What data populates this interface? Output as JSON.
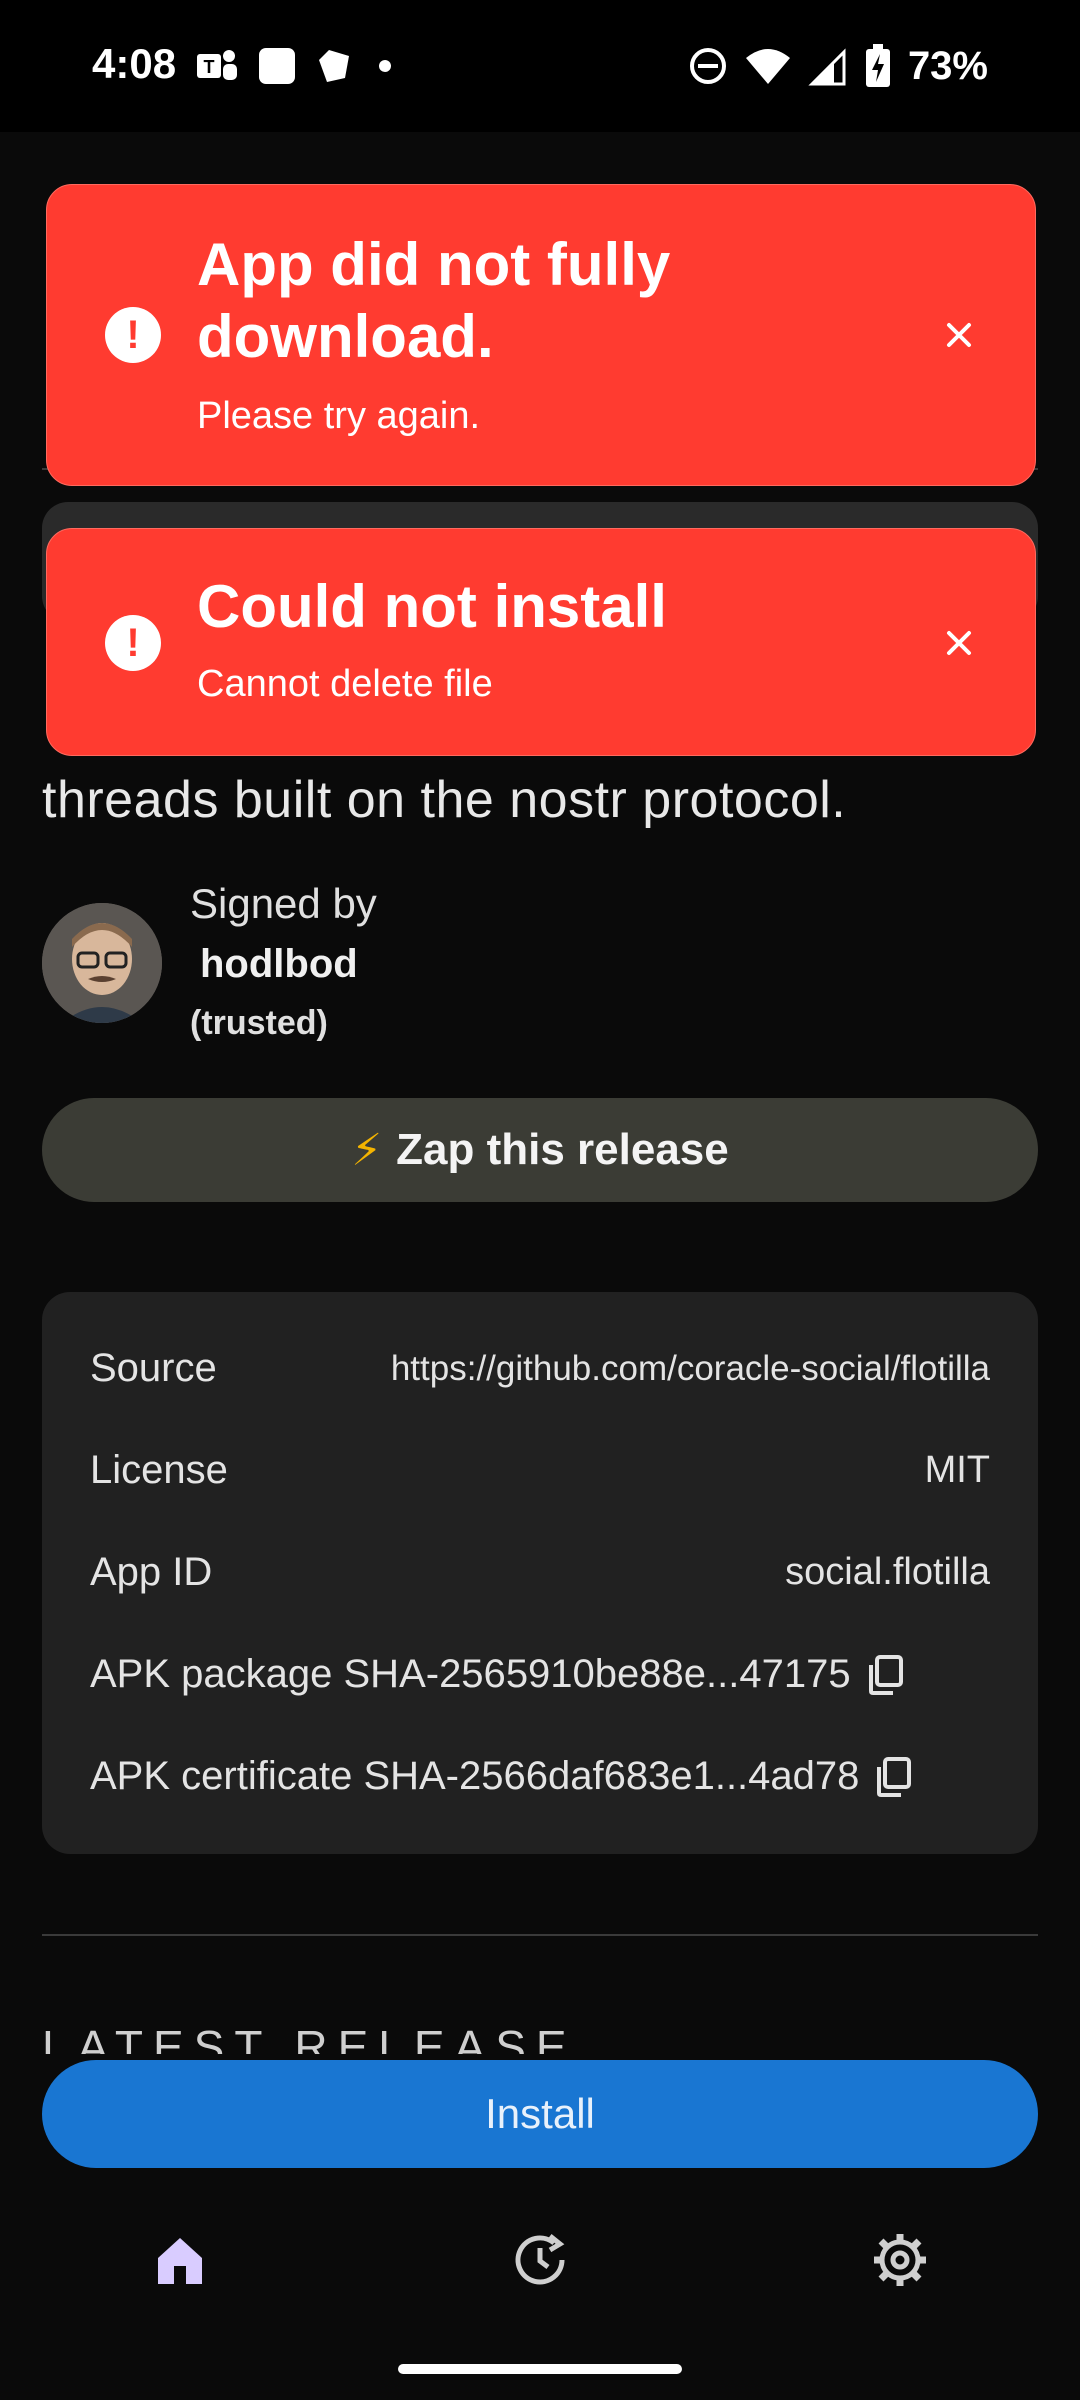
{
  "status_bar": {
    "time": "4:08",
    "battery": "73%"
  },
  "app": {
    "description": "threads built on the nostr protocol.",
    "signed_label": "Signed by",
    "signer_name": "hodlbod",
    "signer_status": "(trusted)",
    "zap_button": "Zap this release",
    "zap_emoji": "⚡",
    "info": {
      "source_label": "Source",
      "source_value": "https://github.com/coracle-social/flotilla",
      "license_label": "License",
      "license_value": "MIT",
      "appid_label": "App ID",
      "appid_value": "social.flotilla",
      "apk_package_label": "APK package SHA-256",
      "apk_package_value": "5910be88e...47175",
      "apk_cert_label": "APK certificate SHA-256",
      "apk_cert_value": "6daf683e1...4ad78"
    },
    "latest_release_heading": "LATEST RELEASE",
    "install_button": "Install"
  },
  "toasts": [
    {
      "title": "App did not fully download.",
      "message": "Please try again."
    },
    {
      "title": "Could not install",
      "message": "Cannot delete file"
    }
  ],
  "nav": {
    "items": [
      "home-icon",
      "history-icon",
      "settings-icon"
    ],
    "active": "home-icon"
  },
  "colors": {
    "toast_red": "#ff3b30",
    "install_blue": "#1976d2",
    "nav_active": "#d9ccff"
  }
}
